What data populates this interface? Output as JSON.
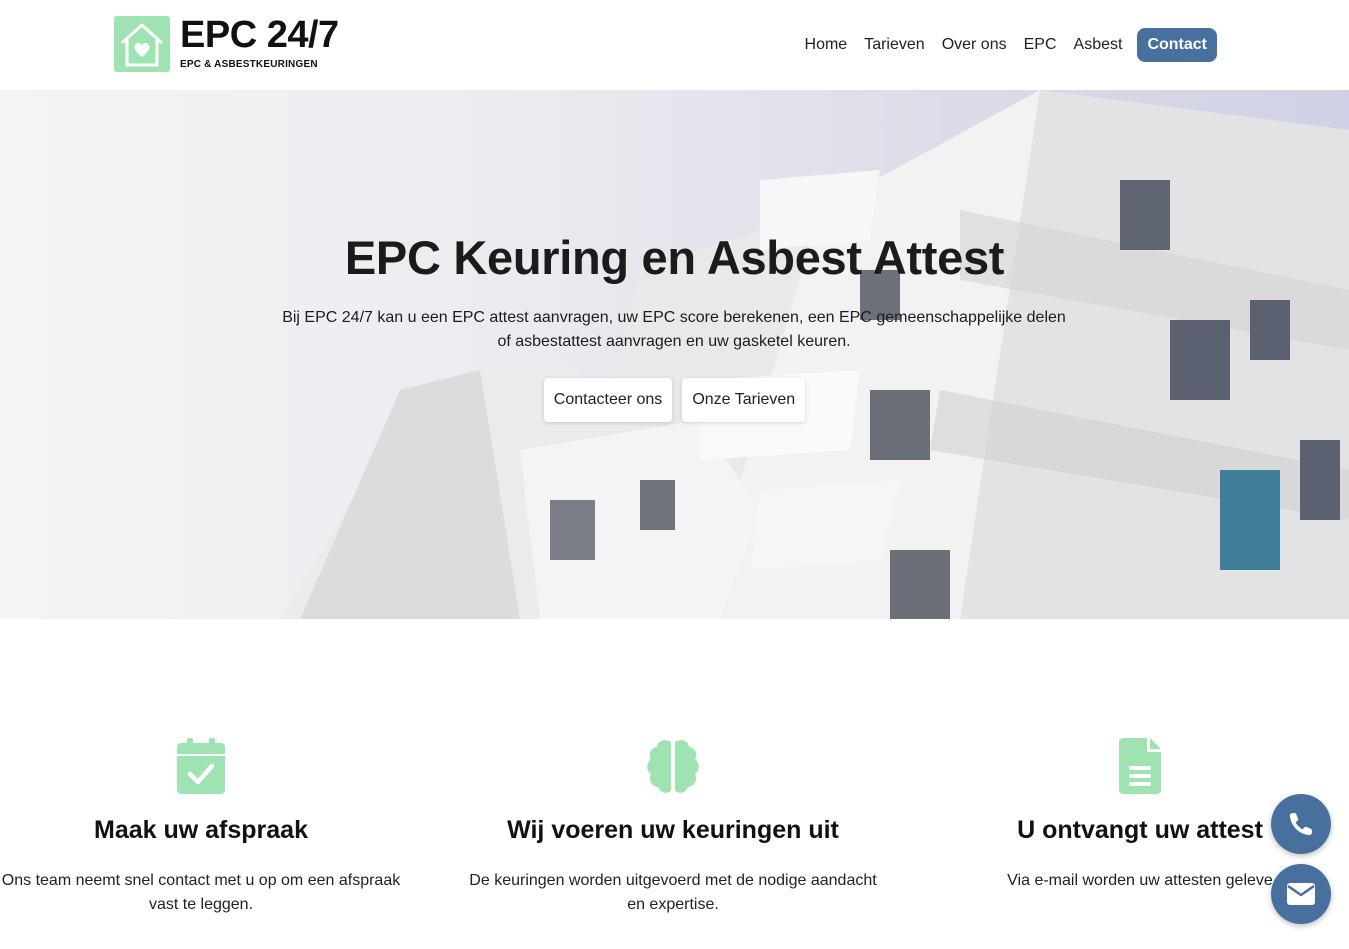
{
  "header": {
    "logo_title": "EPC 24/7",
    "logo_subtitle": "EPC & ASBESTKEURINGEN",
    "nav": [
      "Home",
      "Tarieven",
      "Over ons",
      "EPC",
      "Asbest"
    ],
    "contact_label": "Contact"
  },
  "hero": {
    "title": "EPC Keuring en Asbest Attest",
    "subtitle": "Bij EPC 24/7 kan u een EPC attest aanvragen, uw EPC score berekenen, een EPC gemeenschappelijke delen of asbestattest aanvragen en uw gasketel keuren.",
    "button_contact": "Contacteer ons",
    "button_prices": "Onze Tarieven"
  },
  "features": [
    {
      "icon": "calendar-check-icon",
      "title": "Maak uw afspraak",
      "text": "Ons team neemt snel contact met u op om een afspraak vast te leggen."
    },
    {
      "icon": "brain-icon",
      "title": "Wij voeren uw keuringen uit",
      "text": "De keuringen worden uitgevoerd met de nodige aandacht en expertise."
    },
    {
      "icon": "document-icon",
      "title": "U ontvangt uw attest",
      "text": "Via e-mail worden uw attesten geleve"
    }
  ],
  "floating": {
    "phone_icon": "phone-icon",
    "mail_icon": "envelope-icon"
  },
  "colors": {
    "accent": "#47709e",
    "icon_green": "#9fe3b2"
  }
}
